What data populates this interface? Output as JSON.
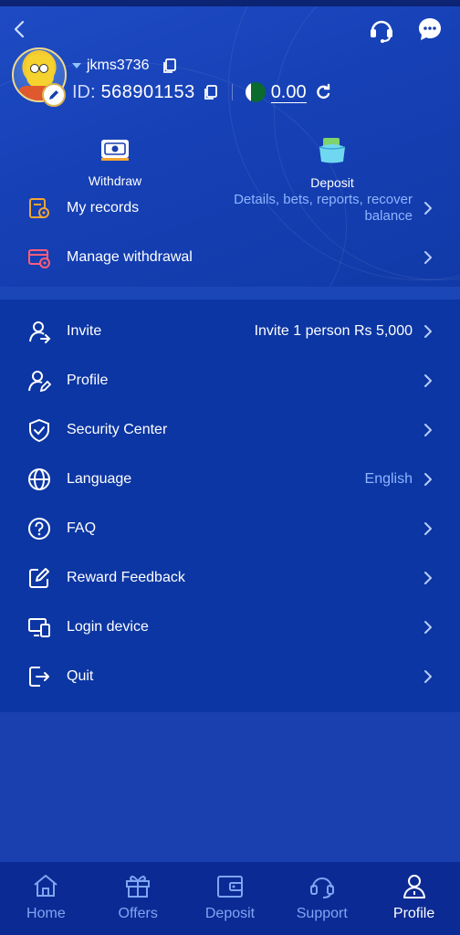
{
  "header": {
    "username": "jkms3736",
    "id_label": "ID:",
    "id_value": "568901153",
    "balance": "0.00"
  },
  "actions": {
    "withdraw": "Withdraw",
    "deposit": "Deposit"
  },
  "top_menu": [
    {
      "label": "My records",
      "right": "Details, bets, reports, recover balance",
      "right_line1": "Details, bets, reports, recover",
      "right_line2": "balance"
    },
    {
      "label": "Manage withdrawal",
      "right": ""
    }
  ],
  "menu": [
    {
      "label": "Invite",
      "right": "Invite 1 person Rs 5,000"
    },
    {
      "label": "Profile",
      "right": ""
    },
    {
      "label": "Security Center",
      "right": ""
    },
    {
      "label": "Language",
      "right": "English"
    },
    {
      "label": "FAQ",
      "right": ""
    },
    {
      "label": "Reward Feedback",
      "right": ""
    },
    {
      "label": "Login device",
      "right": ""
    },
    {
      "label": "Quit",
      "right": ""
    }
  ],
  "tabs": [
    {
      "label": "Home",
      "icon": "home-icon",
      "active": false
    },
    {
      "label": "Offers",
      "icon": "gift-icon",
      "active": false
    },
    {
      "label": "Deposit",
      "icon": "wallet-icon",
      "active": false
    },
    {
      "label": "Support",
      "icon": "headset-icon",
      "active": false
    },
    {
      "label": "Profile",
      "icon": "user-icon",
      "active": true
    }
  ],
  "colors": {
    "background": "#1a3fae",
    "list": "#0c36a3",
    "tabbar": "#0b2a94",
    "muted_text": "#8fb4ff",
    "accent_orange": "#f3a534",
    "accent_red": "#ff5e78"
  }
}
